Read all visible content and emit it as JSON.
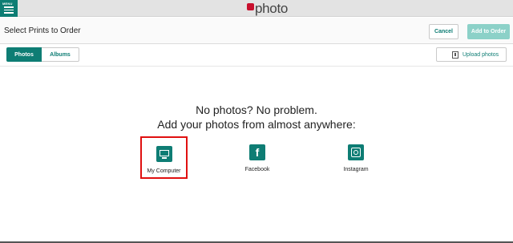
{
  "header": {
    "menu_label": "MENU",
    "brand_name": "photo"
  },
  "titlebar": {
    "title": "Select Prints to Order",
    "cancel_label": "Cancel",
    "add_to_order_label": "Add to Order"
  },
  "tabs": [
    {
      "label": "Photos",
      "active": true
    },
    {
      "label": "Albums",
      "active": false
    }
  ],
  "upload": {
    "label": "Upload photos",
    "icon": "upload-icon"
  },
  "empty_state": {
    "line1": "No photos? No problem.",
    "line2": "Add your photos from almost anywhere:"
  },
  "sources": [
    {
      "label": "My Computer",
      "icon": "monitor-icon",
      "highlighted": true
    },
    {
      "label": "Facebook",
      "icon": "facebook-icon",
      "highlighted": false
    },
    {
      "label": "Instagram",
      "icon": "instagram-icon",
      "highlighted": false
    }
  ],
  "colors": {
    "accent": "#0e7d74",
    "accent_light": "#8cd1c8",
    "highlight_border": "#e01010",
    "brand_red": "#c8102e"
  }
}
